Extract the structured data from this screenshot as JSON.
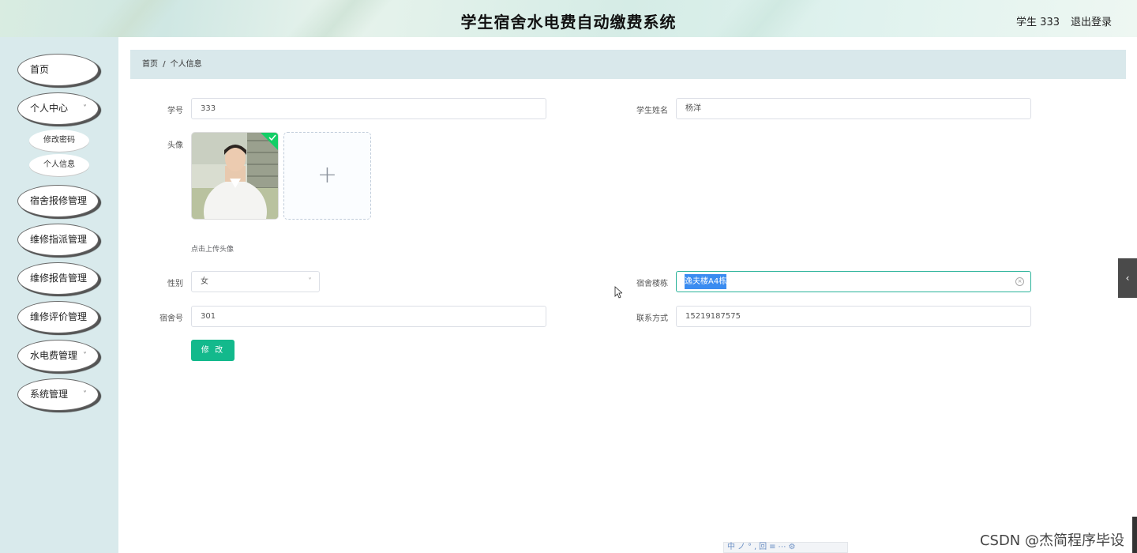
{
  "header": {
    "title": "学生宿舍水电费自动缴费系统",
    "user": "学生 333",
    "logout": "退出登录"
  },
  "sidebar": {
    "items": [
      {
        "label": "首页",
        "has_chevron": false
      },
      {
        "label": "个人中心",
        "has_chevron": true
      },
      {
        "label": "宿舍报修管理",
        "has_chevron": false
      },
      {
        "label": "维修指派管理",
        "has_chevron": false
      },
      {
        "label": "维修报告管理",
        "has_chevron": false
      },
      {
        "label": "维修评价管理",
        "has_chevron": false
      },
      {
        "label": "水电费管理",
        "has_chevron": true
      },
      {
        "label": "系统管理",
        "has_chevron": true
      }
    ],
    "subitems": [
      {
        "label": "修改密码"
      },
      {
        "label": "个人信息"
      }
    ],
    "chevron": "˅"
  },
  "breadcrumb": {
    "home": "首页",
    "separator": "/",
    "current": "个人信息"
  },
  "form": {
    "student_no": {
      "label": "学号",
      "value": "333"
    },
    "student_name": {
      "label": "学生姓名",
      "value": "杨洋"
    },
    "avatar": {
      "label": "头像",
      "upload_hint": "点击上传头像",
      "plus": "+",
      "check": "✓"
    },
    "gender": {
      "label": "性别",
      "value": "女",
      "arrow": "˅"
    },
    "building": {
      "label": "宿舍楼栋",
      "value": "逸夫楼A4栋",
      "clear": "×"
    },
    "room_no": {
      "label": "宿舍号",
      "value": "301"
    },
    "contact": {
      "label": "联系方式",
      "value": "15219187575"
    },
    "submit_label": "修 改"
  },
  "side_tab": {
    "icon": "‹"
  },
  "watermark": "CSDN @杰简程序毕设",
  "ime_bar": "中ノ°,回≡⋯⚙",
  "colors": {
    "accent": "#13b98c",
    "sidebar_bg": "#d9eaec",
    "breadcrumb_bg": "#d9e8eb",
    "selection": "#3b8cf0"
  }
}
